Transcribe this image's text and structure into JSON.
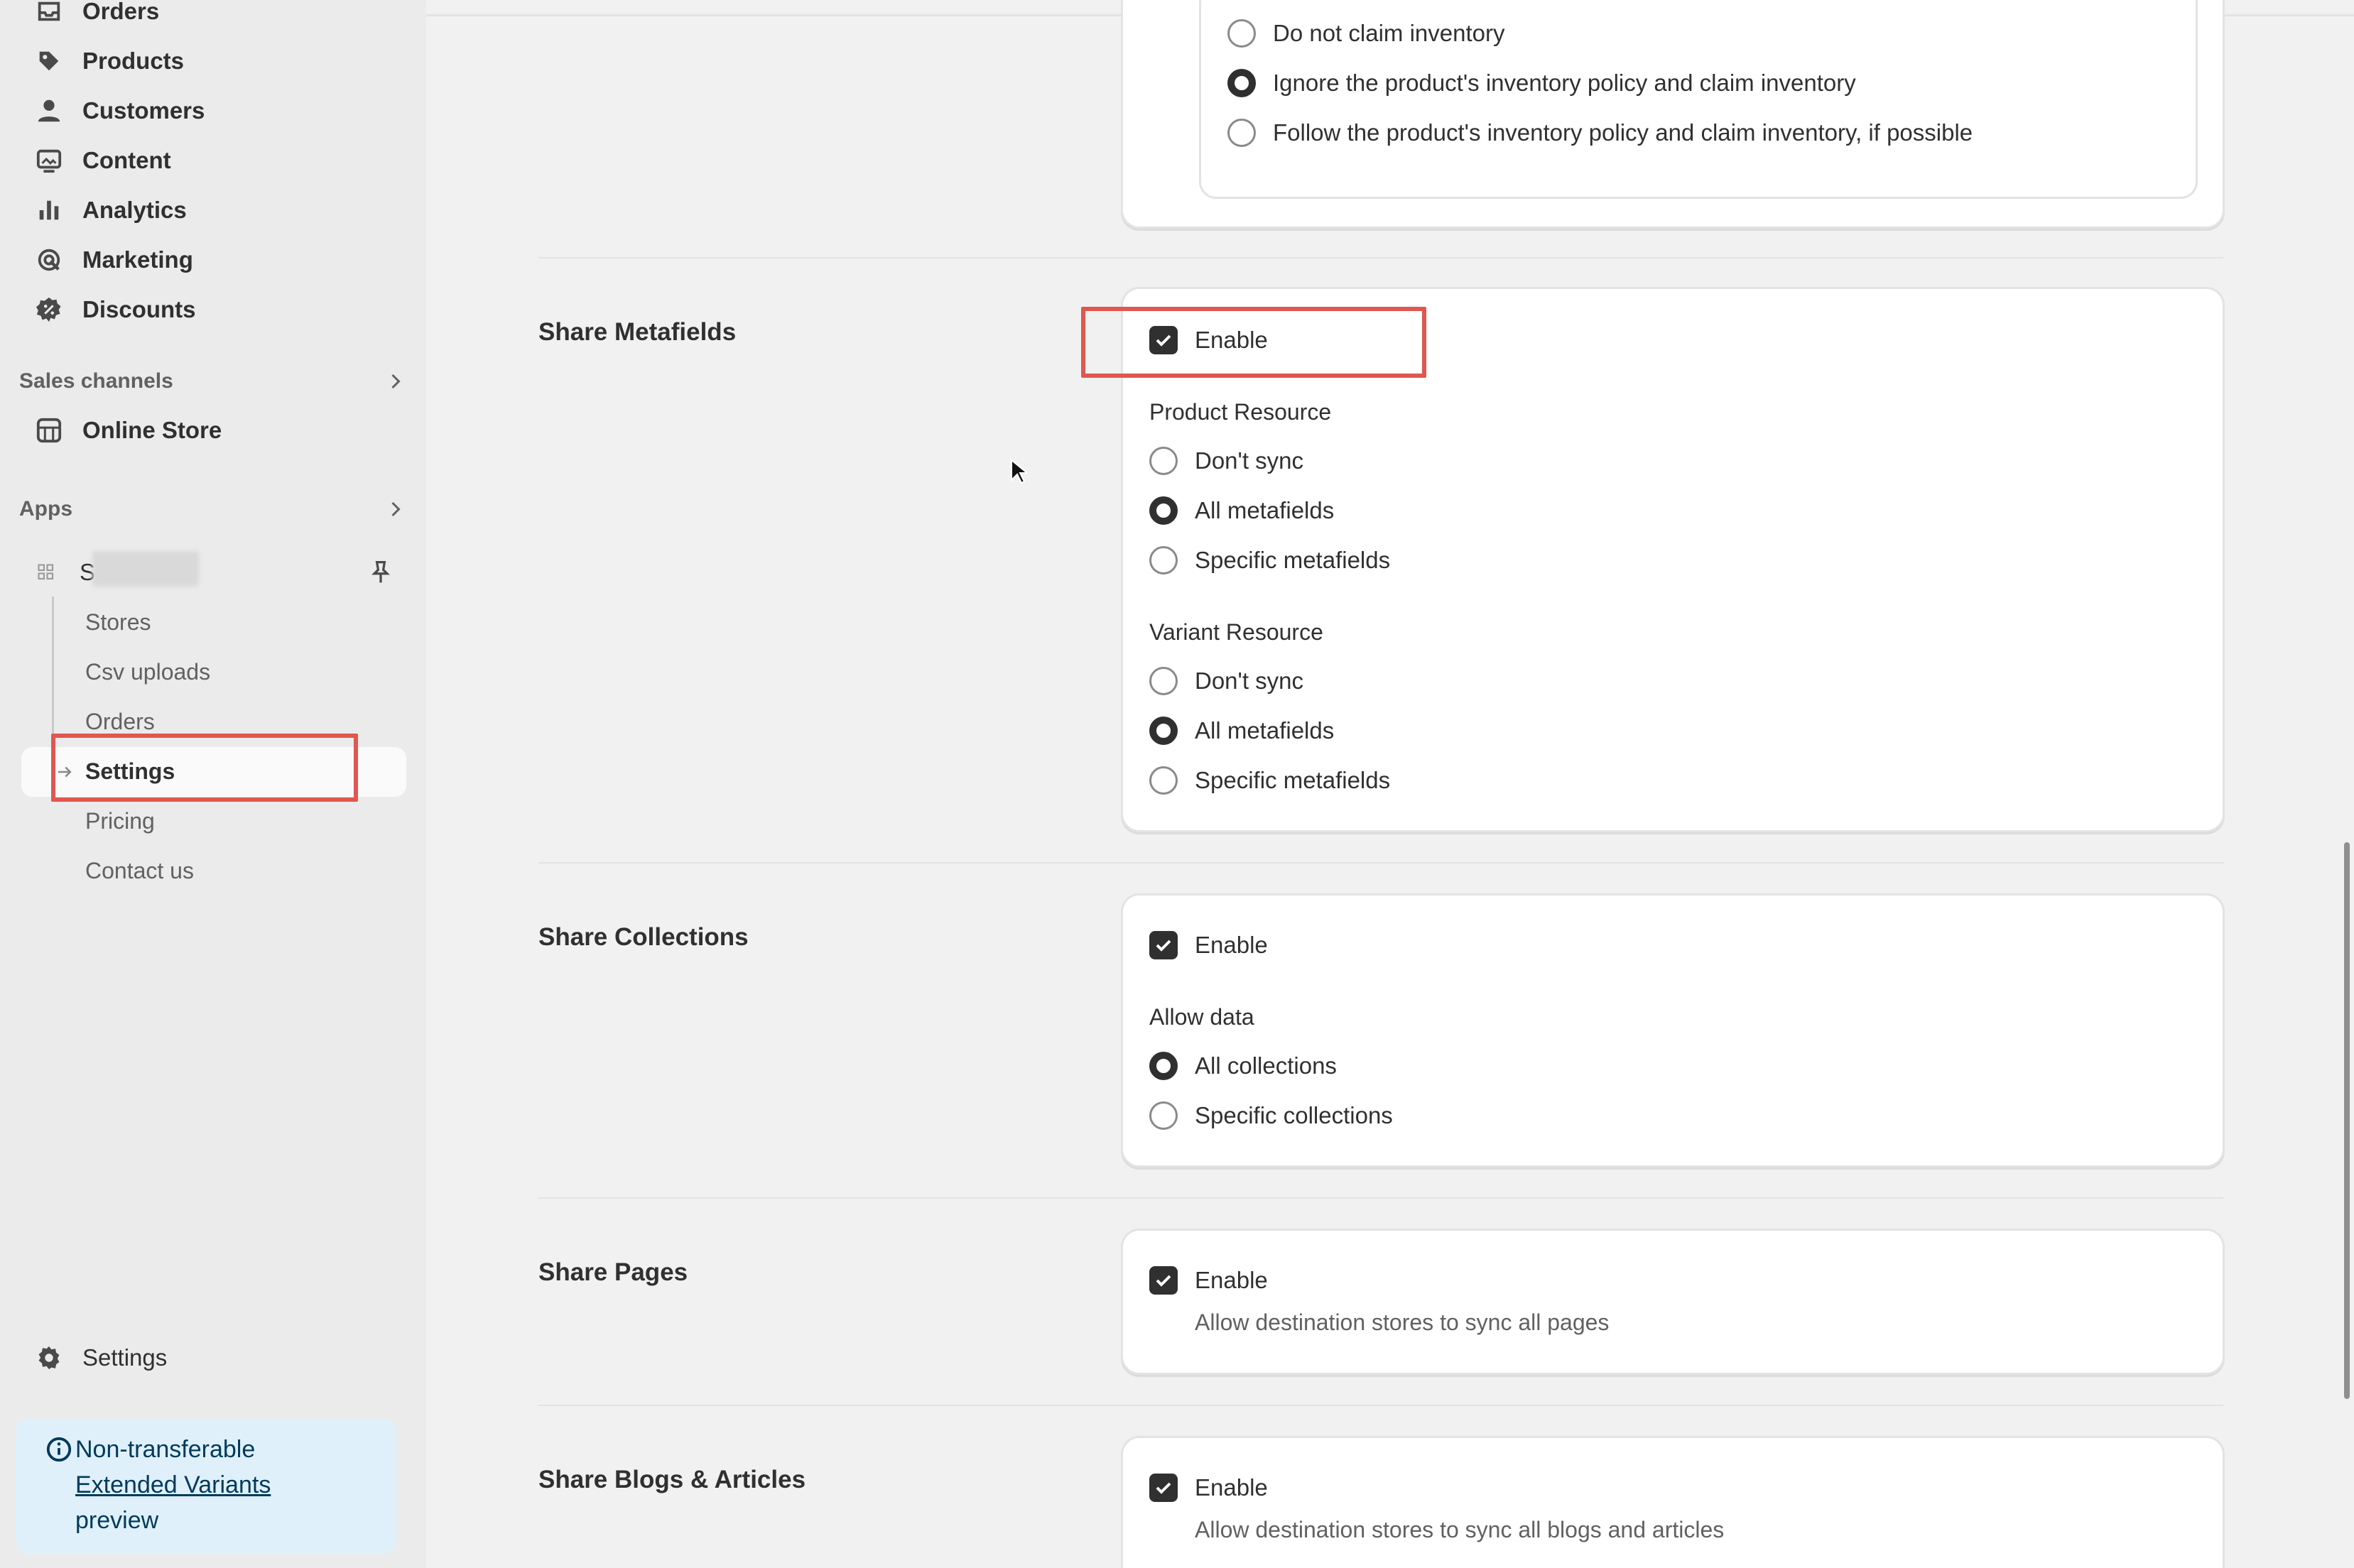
{
  "sidebar": {
    "nav": [
      {
        "label": "Orders",
        "icon": "inbox-icon"
      },
      {
        "label": "Products",
        "icon": "tag-icon"
      },
      {
        "label": "Customers",
        "icon": "person-icon"
      },
      {
        "label": "Content",
        "icon": "image-icon"
      },
      {
        "label": "Analytics",
        "icon": "bar-chart-icon"
      },
      {
        "label": "Marketing",
        "icon": "target-icon"
      },
      {
        "label": "Discounts",
        "icon": "discount-icon"
      }
    ],
    "sales_channels_label": "Sales channels",
    "online_store_label": "Online Store",
    "apps_label": "Apps",
    "app_name_initial": "S",
    "app_sub_items": [
      "Stores",
      "Csv uploads",
      "Orders",
      "Settings",
      "Pricing",
      "Contact us"
    ],
    "settings_label": "Settings",
    "banner": {
      "line1": "Non-transferable",
      "link": "Extended Variants",
      "line3": "preview"
    }
  },
  "main": {
    "inventory_options": [
      {
        "label": "Do not claim inventory",
        "selected": false
      },
      {
        "label": "Ignore the product's inventory policy and claim inventory",
        "selected": true
      },
      {
        "label": "Follow the product's inventory policy and claim inventory, if possible",
        "selected": false
      }
    ],
    "metafields": {
      "title": "Share Metafields",
      "enable_label": "Enable",
      "product_resource_label": "Product Resource",
      "product_options": [
        {
          "label": "Don't sync",
          "selected": false
        },
        {
          "label": "All metafields",
          "selected": true
        },
        {
          "label": "Specific metafields",
          "selected": false
        }
      ],
      "variant_resource_label": "Variant Resource",
      "variant_options": [
        {
          "label": "Don't sync",
          "selected": false
        },
        {
          "label": "All metafields",
          "selected": true
        },
        {
          "label": "Specific metafields",
          "selected": false
        }
      ]
    },
    "collections": {
      "title": "Share Collections",
      "enable_label": "Enable",
      "allow_label": "Allow data",
      "options": [
        {
          "label": "All collections",
          "selected": true
        },
        {
          "label": "Specific collections",
          "selected": false
        }
      ]
    },
    "pages": {
      "title": "Share Pages",
      "enable_label": "Enable",
      "helper": "Allow destination stores to sync all pages"
    },
    "blogs": {
      "title": "Share Blogs & Articles",
      "enable_label": "Enable",
      "helper": "Allow destination stores to sync all blogs and articles"
    }
  },
  "colors": {
    "highlight": "#e0574f",
    "banner_bg": "#dff0fb",
    "checkbox": "#303030"
  }
}
